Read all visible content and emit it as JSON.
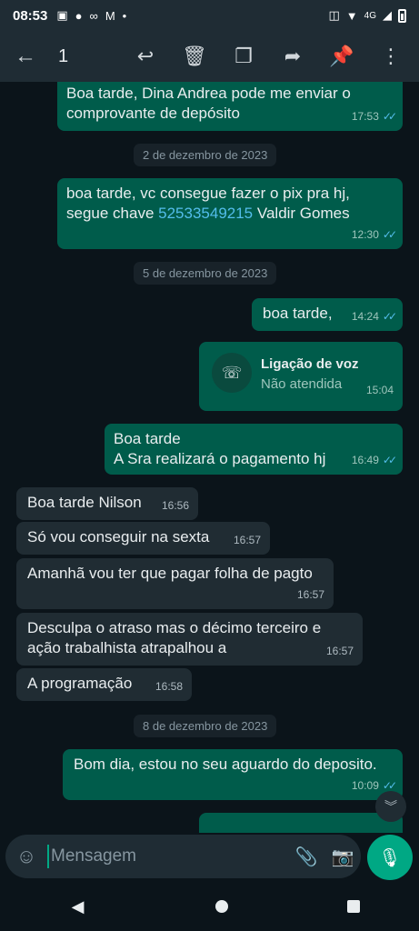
{
  "status_bar": {
    "time": "08:53",
    "network": "4G"
  },
  "action_bar": {
    "selected_count": "1"
  },
  "messages": [
    {
      "text": "Boa tarde, Dina Andrea pode me enviar o comprovante de depósito",
      "time": "17:53"
    },
    {
      "date": "2 de dezembro de 2023"
    },
    {
      "text_part1": "boa tarde, vc consegue fazer o pix pra hj, segue chave ",
      "link": "52533549215",
      "text_part2": " Valdir Gomes",
      "time": "12:30"
    },
    {
      "date": "5 de dezembro de 2023"
    },
    {
      "text": "boa tarde,",
      "time": "14:24"
    },
    {
      "call_title": "Ligação de voz",
      "call_status": "Não atendida",
      "time": "15:04"
    },
    {
      "line1": "Boa tarde",
      "line2": "A Sra realizará o pagamento hj",
      "time": "16:49"
    },
    {
      "text": "Boa tarde Nilson",
      "time": "16:56"
    },
    {
      "text": "Só vou conseguir na sexta",
      "time": "16:57"
    },
    {
      "text": "Amanhã vou ter que pagar folha de pagto",
      "time": "16:57"
    },
    {
      "line1": "Desculpa o atraso mas o décimo terceiro e",
      "line2": "ação trabalhista atrapalhou a",
      "time": "16:57"
    },
    {
      "text": "A programação",
      "time": "16:58"
    },
    {
      "date": "8 de dezembro de 2023"
    },
    {
      "text": "Bom dia, estou no seu aguardo do deposito.",
      "time": "10:09"
    }
  ],
  "input": {
    "placeholder": "Mensagem"
  },
  "colors": {
    "outgoing": "#005c4b",
    "incoming": "#202c33",
    "accent": "#00a884",
    "read_ticks": "#53bdeb"
  }
}
